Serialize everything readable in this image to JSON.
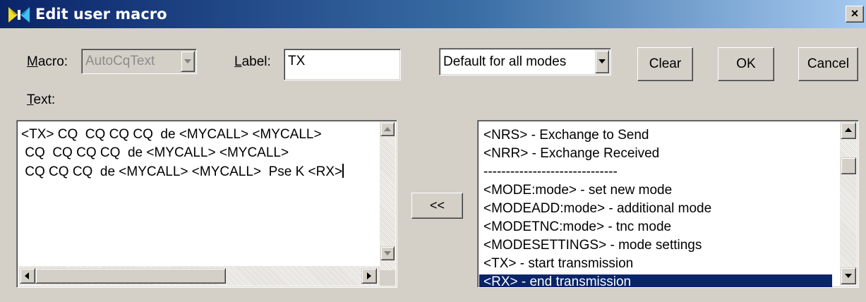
{
  "window": {
    "title": "Edit user macro",
    "close_label": "×",
    "app_icon": "butterfly-icon"
  },
  "form": {
    "macro_label": "Macro:",
    "macro_underline": "M",
    "macro_rest": "acro:",
    "macro_value": "AutoCqText",
    "label_label_underline": "L",
    "label_label_rest": "abel:",
    "label_value": "TX",
    "text_label_underline": "T",
    "text_label_rest": "ext:",
    "mode_value": "Default for all modes"
  },
  "buttons": {
    "clear": "Clear",
    "ok": "OK",
    "cancel": "Cancel",
    "insert": "<<"
  },
  "macro_text": {
    "lines": [
      "<TX> CQ  CQ CQ CQ  de <MYCALL> <MYCALL>",
      " CQ  CQ CQ CQ  de <MYCALL> <MYCALL>",
      " CQ CQ CQ  de <MYCALL> <MYCALL>  Pse K <RX>"
    ]
  },
  "tag_list": {
    "items": [
      "<NRS> - Exchange to Send",
      "<NRR> - Exchange Received",
      "------------------------------",
      "<MODE:mode> - set new mode",
      "<MODEADD:mode> - additional mode",
      "<MODETNC:mode> - tnc mode",
      "<MODESETTINGS> - mode settings",
      "<TX> - start transmission",
      "<RX> - end transmission"
    ],
    "selected_index": 8
  },
  "colors": {
    "selection": "#0a246a",
    "dialog_face": "#d4d0c8",
    "title_gradient_start": "#0a246a",
    "title_gradient_end": "#a6caf0"
  }
}
